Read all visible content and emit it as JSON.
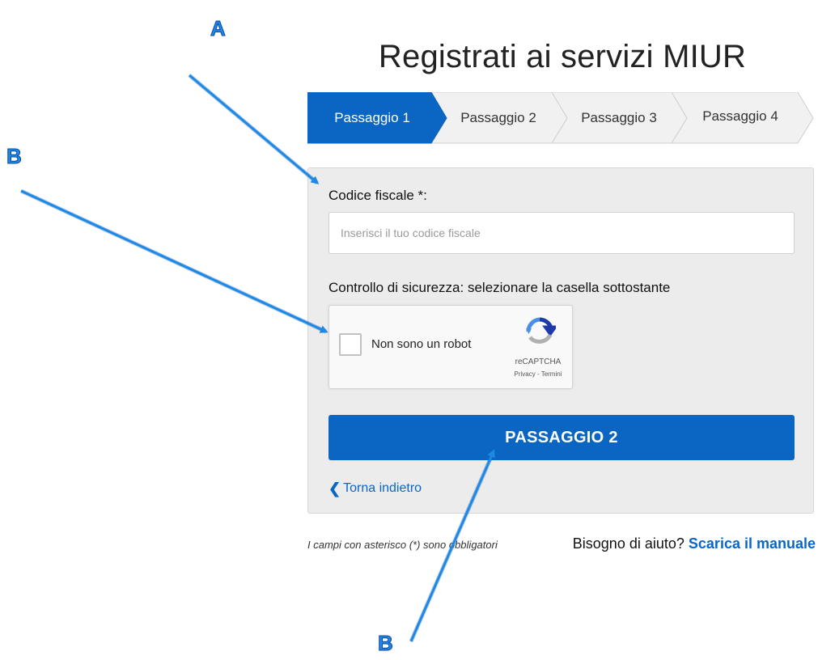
{
  "title": "Registrati ai servizi MIUR",
  "stepper": {
    "steps": [
      {
        "label": "Passaggio 1",
        "active": true
      },
      {
        "label": "Passaggio 2",
        "active": false
      },
      {
        "label": "Passaggio 3",
        "active": false
      },
      {
        "label": "Passaggio 4",
        "active": false
      }
    ]
  },
  "form": {
    "codice_fiscale_label": "Codice fiscale *:",
    "codice_fiscale_placeholder": "Inserisci il tuo codice fiscale",
    "codice_fiscale_value": "",
    "security_label": "Controllo di sicurezza: selezionare la casella sottostante",
    "recaptcha": {
      "checkbox_label": "Non sono un robot",
      "checked": false,
      "brand": "reCAPTCHA",
      "links": "Privacy - Termini"
    },
    "submit_label": "PASSAGGIO 2",
    "back_label": "Torna indietro"
  },
  "footer": {
    "required_note": "I campi con asterisco (*) sono obbligatori",
    "help_question": "Bisogno di aiuto?",
    "help_link": "Scarica il manuale"
  },
  "annotations": {
    "letters": [
      "A",
      "B",
      "B"
    ]
  },
  "colors": {
    "primary": "#0a66c2",
    "panel_bg": "#ececec",
    "annotation": "#1e88e5"
  }
}
